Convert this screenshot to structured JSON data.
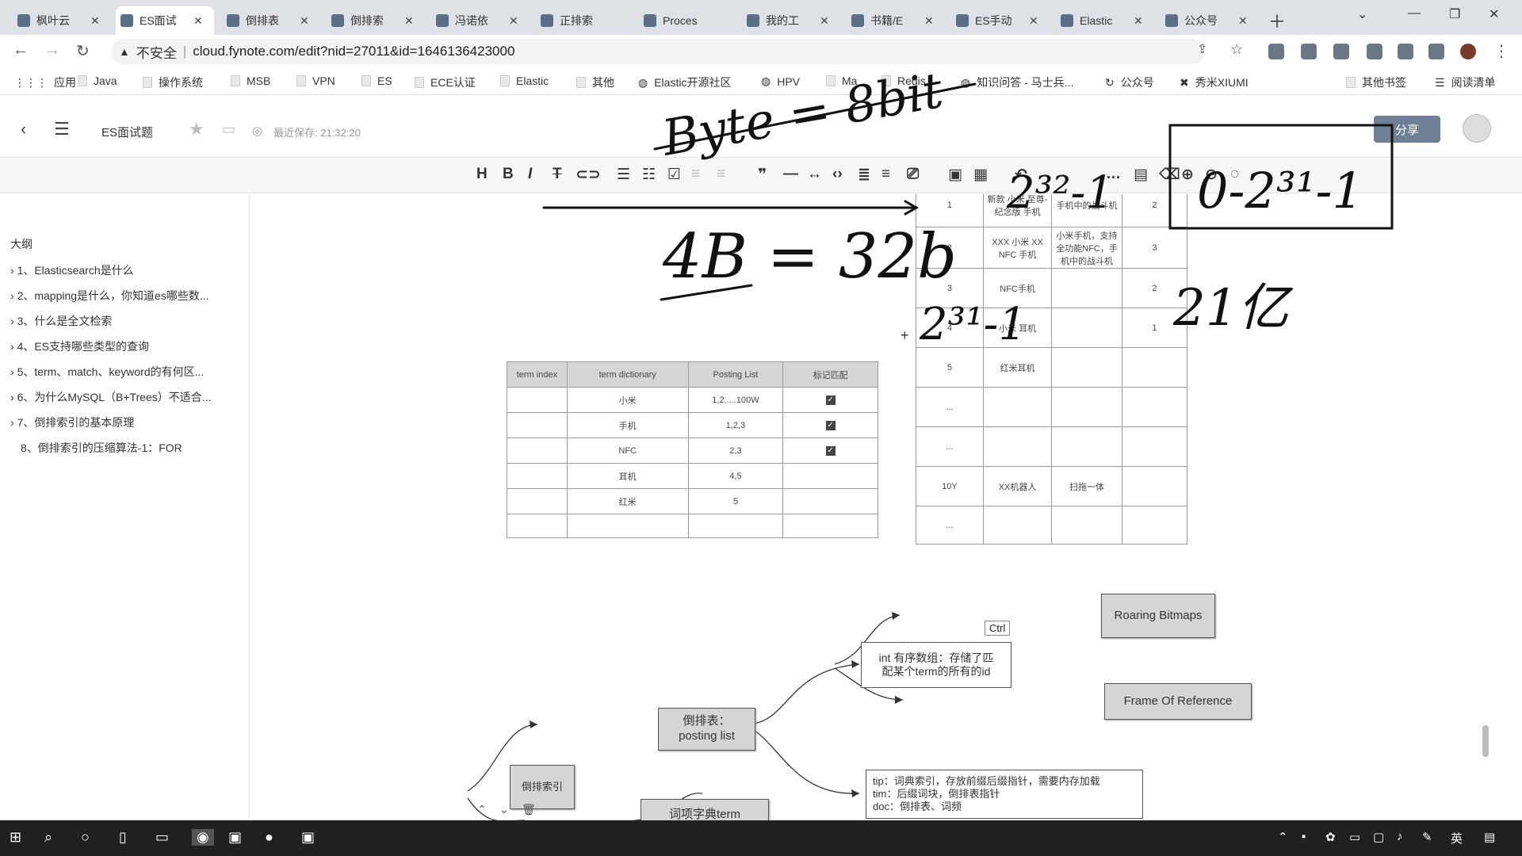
{
  "browser": {
    "tabs": [
      {
        "label": "枫叶云"
      },
      {
        "label": "ES面试"
      },
      {
        "label": "倒排表"
      },
      {
        "label": "倒排索"
      },
      {
        "label": "冯诺依"
      },
      {
        "label": "正排索"
      },
      {
        "label": "Proces"
      },
      {
        "label": "我的工"
      },
      {
        "label": "书籍/E"
      },
      {
        "label": "ES手动"
      },
      {
        "label": "Elastic"
      },
      {
        "label": "公众号"
      }
    ],
    "insecure_label": "不安全",
    "url": "cloud.fynote.com/edit?nid=27011&id=1646136423000",
    "bookmarks": [
      "应用",
      "Java",
      "操作系统",
      "MSB",
      "VPN",
      "ES",
      "ECE认证",
      "Elastic",
      "其他",
      "Elastic开源社区",
      "HPV",
      "Ma",
      "Redis",
      "知识问答 - 马士兵...",
      "公众号",
      "秀米XIUMI"
    ],
    "other_bookmarks": "其他书签",
    "reading_list": "阅读清单"
  },
  "app": {
    "doc_title": "ES面试题",
    "save_status": "最近保存: 21:32:20",
    "share_label": "分享"
  },
  "outline": {
    "title": "大纲",
    "items": [
      "1、Elasticsearch是什么",
      "2、mapping是什么，你知道es哪些数...",
      "3、什么是全文检索",
      "4、ES支持哪些类型的查询",
      "5、term、match、keyword的有何区...",
      "6、为什么MySQL（B+Trees）不适合...",
      "7、倒排索引的基本原理",
      "8、倒排索引的压缩算法-1：FOR"
    ]
  },
  "term_table": {
    "headers": [
      "term index",
      "term dictionary",
      "Posting List",
      "标记匹配"
    ],
    "rows": [
      [
        "",
        "小米",
        "1,2.....100W",
        "✓"
      ],
      [
        "",
        "手机",
        "1,2,3",
        "✓"
      ],
      [
        "",
        "NFC",
        "2,3",
        "✓"
      ],
      [
        "",
        "耳机",
        "4,5",
        ""
      ],
      [
        "",
        "红米",
        "5",
        ""
      ],
      [
        "",
        "",
        "",
        ""
      ]
    ]
  },
  "doc_table": {
    "rows": [
      [
        "1",
        "新款 小米 至尊-纪念版 手机",
        "手机中的战斗机",
        "2"
      ],
      [
        "2",
        "XXX 小米 XX NFC 手机",
        "小米手机，支持全功能NFC，手机中的战斗机",
        "3"
      ],
      [
        "3",
        "NFC手机",
        "",
        "2"
      ],
      [
        "4",
        "小米 耳机",
        "",
        "1"
      ],
      [
        "5",
        "红米耳机",
        "",
        ""
      ],
      [
        "...",
        "",
        "",
        ""
      ],
      [
        "...",
        "",
        "",
        ""
      ],
      [
        "10Y",
        "XX机器人",
        "扫拖一体",
        ""
      ],
      [
        "...",
        "",
        "",
        ""
      ]
    ]
  },
  "ctrl_tooltip": "Ctrl",
  "mindmap": {
    "root": "倒排索引",
    "posting": "倒排表：\nposting list",
    "dict": "词项字典term",
    "int_array": "int 有序数组：存储了匹\n配某个term的所有的id",
    "roaring": "Roaring Bitmaps",
    "for": "Frame Of Reference",
    "tip": "tip：词典索引，存放前缀后缀指针，需要内存加载\ntim：后缀词块，倒排表指针\ndoc：倒排表、词频"
  },
  "annotations": {
    "byte": "Byte = 8bit",
    "fourb": "4B = 32b",
    "pow1": "2³²-1",
    "pow2": "2³¹-1",
    "range": "0-2³¹-1",
    "yi": "21亿"
  },
  "taskbar": {
    "lang": "英"
  }
}
